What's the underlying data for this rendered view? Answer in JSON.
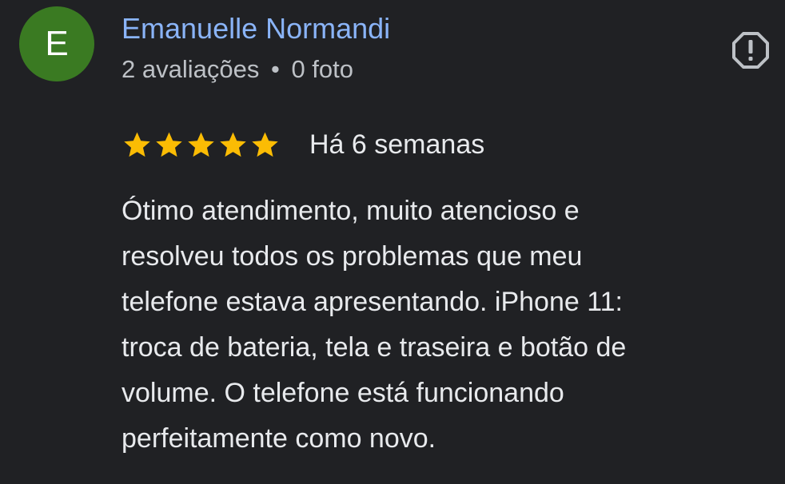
{
  "reviewer": {
    "initial": "E",
    "name": "Emanuelle Normandi",
    "review_count": "2 avaliações",
    "separator": "•",
    "photo_count": "0 foto",
    "avatar_color": "#3a7a22"
  },
  "actions": {
    "report_icon": "report-flag-icon"
  },
  "rating": {
    "stars": 5,
    "max_stars": 5,
    "star_color": "#fbbc04",
    "date": "Há 6 semanas"
  },
  "review": {
    "lines": [
      "Ótimo atendimento, muito atencioso e",
      "resolveu todos os problemas que meu",
      "telefone estava apresentando. iPhone 11:",
      "troca de bateria, tela e traseira e botão de",
      "volume. O telefone está funcionando",
      "perfeitamente como novo."
    ]
  },
  "colors": {
    "background": "#202124",
    "name": "#8ab4f8",
    "meta": "#bdc1c6",
    "text": "#e8eaed"
  }
}
